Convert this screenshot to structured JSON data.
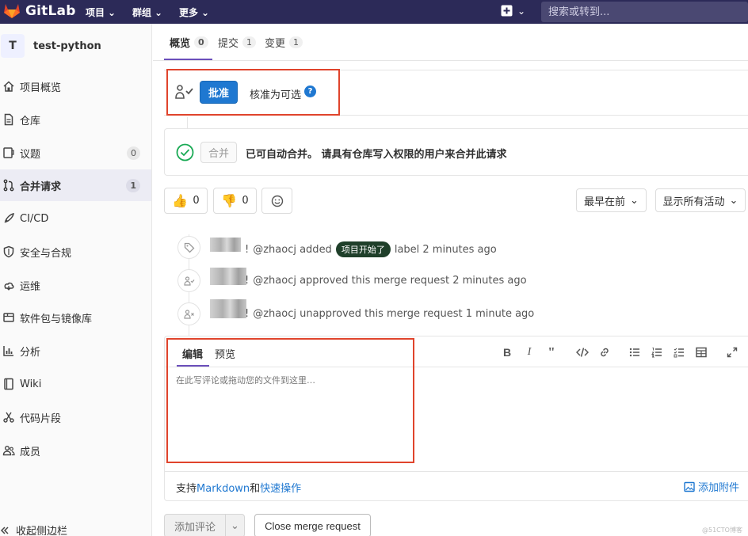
{
  "navbar": {
    "brand": "GitLab",
    "menus": [
      "项目",
      "群组",
      "更多"
    ],
    "search_placeholder": "搜索或转到..."
  },
  "sidebar": {
    "project_initial": "T",
    "project_name": "test-python",
    "items": [
      {
        "label": "项目概览",
        "icon": "home-icon"
      },
      {
        "label": "仓库",
        "icon": "doc-icon"
      },
      {
        "label": "议题",
        "icon": "issues-icon",
        "count": "0"
      },
      {
        "label": "合并请求",
        "icon": "merge-request-icon",
        "count": "1",
        "active": true
      },
      {
        "label": "CI/CD",
        "icon": "rocket-icon"
      },
      {
        "label": "安全与合规",
        "icon": "shield-icon"
      },
      {
        "label": "运维",
        "icon": "cloud-icon"
      },
      {
        "label": "软件包与镜像库",
        "icon": "package-icon"
      },
      {
        "label": "分析",
        "icon": "chart-icon"
      },
      {
        "label": "Wiki",
        "icon": "book-icon"
      },
      {
        "label": "代码片段",
        "icon": "scissors-icon"
      },
      {
        "label": "成员",
        "icon": "users-icon"
      }
    ],
    "collapse_label": "收起侧边栏"
  },
  "tabs": [
    {
      "label": "概览",
      "count": "0"
    },
    {
      "label": "提交",
      "count": "1"
    },
    {
      "label": "变更",
      "count": "1"
    }
  ],
  "approval": {
    "button": "批准",
    "optional_text": "核准为可选",
    "help": "?"
  },
  "merge": {
    "button": "合并",
    "message": "已可自动合并。 请具有仓库写入权限的用户来合并此请求"
  },
  "reactions": {
    "thumbs_up": "0",
    "thumbs_down": "0"
  },
  "sort": {
    "order": "最早在前",
    "filter": "显示所有活动"
  },
  "notes": [
    {
      "pre": "!",
      "text_before": "@zhaocj added",
      "label": "项目开始了",
      "text_after": "label 2 minutes ago"
    },
    {
      "pre": "!",
      "text": "@zhaocj approved this merge request 2 minutes ago"
    },
    {
      "pre": "!",
      "text": "@zhaocj unapproved this merge request 1 minute ago"
    }
  ],
  "comment": {
    "tab_edit": "编辑",
    "tab_preview": "预览",
    "placeholder": "在此写评论或拖动您的文件到这里…",
    "footer_prefix": "支持",
    "footer_markdown": "Markdown",
    "footer_and": "和",
    "footer_quick": "快速操作",
    "attach": "添加附件"
  },
  "actions": {
    "add_comment": "添加评论",
    "close": "Close merge request"
  },
  "watermark": "@51CTO博客",
  "colors": {
    "navbar": "#2c2a58",
    "primary": "#1f78d1",
    "highlight_box": "#e0442c",
    "label_bg": "#1f3f2a"
  }
}
